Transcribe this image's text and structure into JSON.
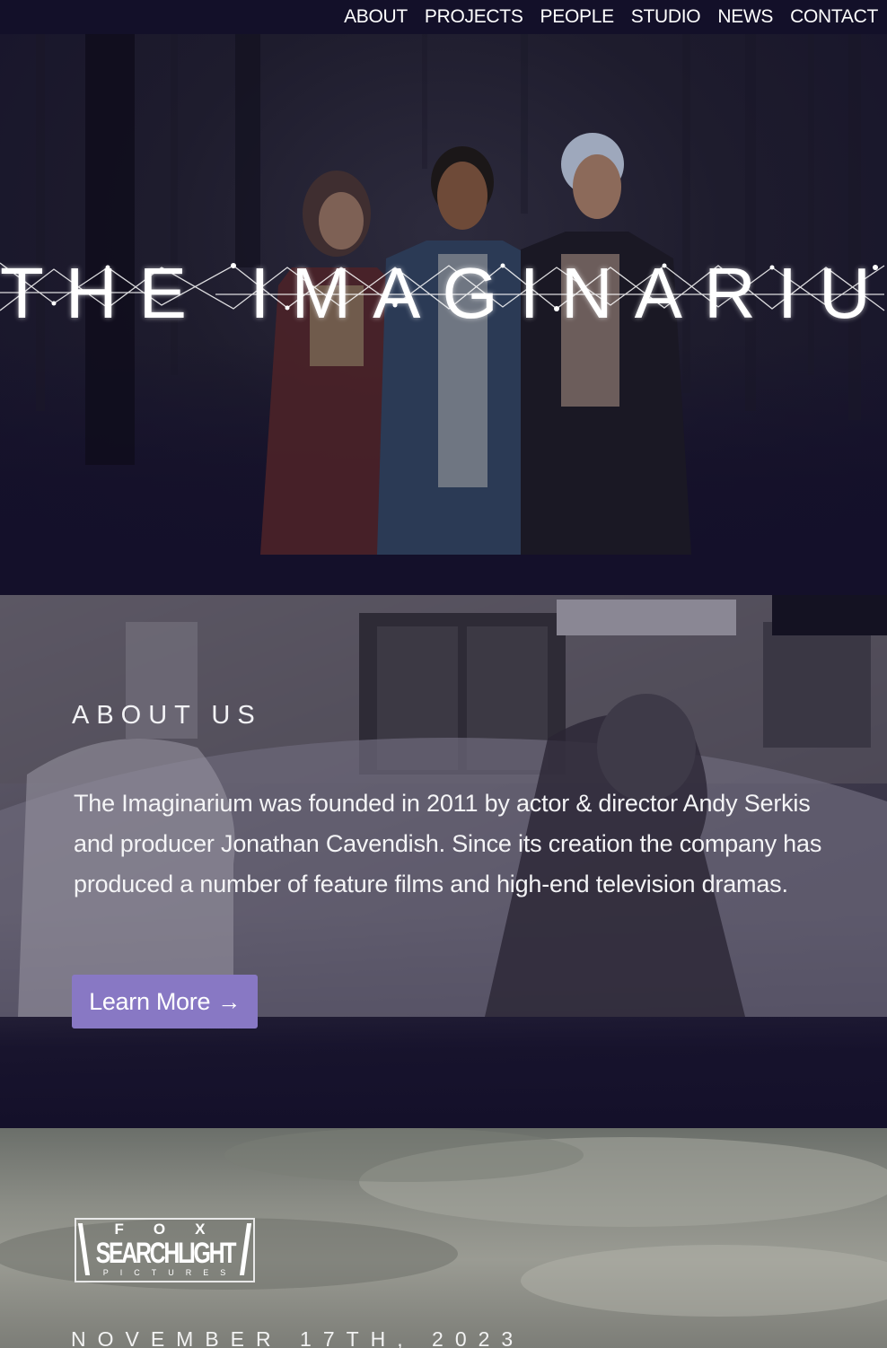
{
  "nav": {
    "items": [
      "ABOUT",
      "PROJECTS",
      "PEOPLE",
      "STUDIO",
      "NEWS",
      "CONTACT"
    ]
  },
  "hero": {
    "title": "THE IMAGINARIUM"
  },
  "about": {
    "heading": "ABOUT US",
    "body": "The Imaginarium was founded in 2011 by actor & director Andy Serkis and producer Jonathan Cavendish. Since its creation the company has produced a number of feature films and high-end television dramas.",
    "button_label": "Learn More",
    "button_arrow": "→",
    "button_color": "#8878c4"
  },
  "project": {
    "logo_top": "FOX",
    "logo_main": "SEARCHLIGHT",
    "logo_bottom": "PICTURES",
    "release_date": "NOVEMBER 17TH, 2023"
  },
  "colors": {
    "background": "#14102a",
    "nav_background": "#131029",
    "text": "#ffffff"
  }
}
